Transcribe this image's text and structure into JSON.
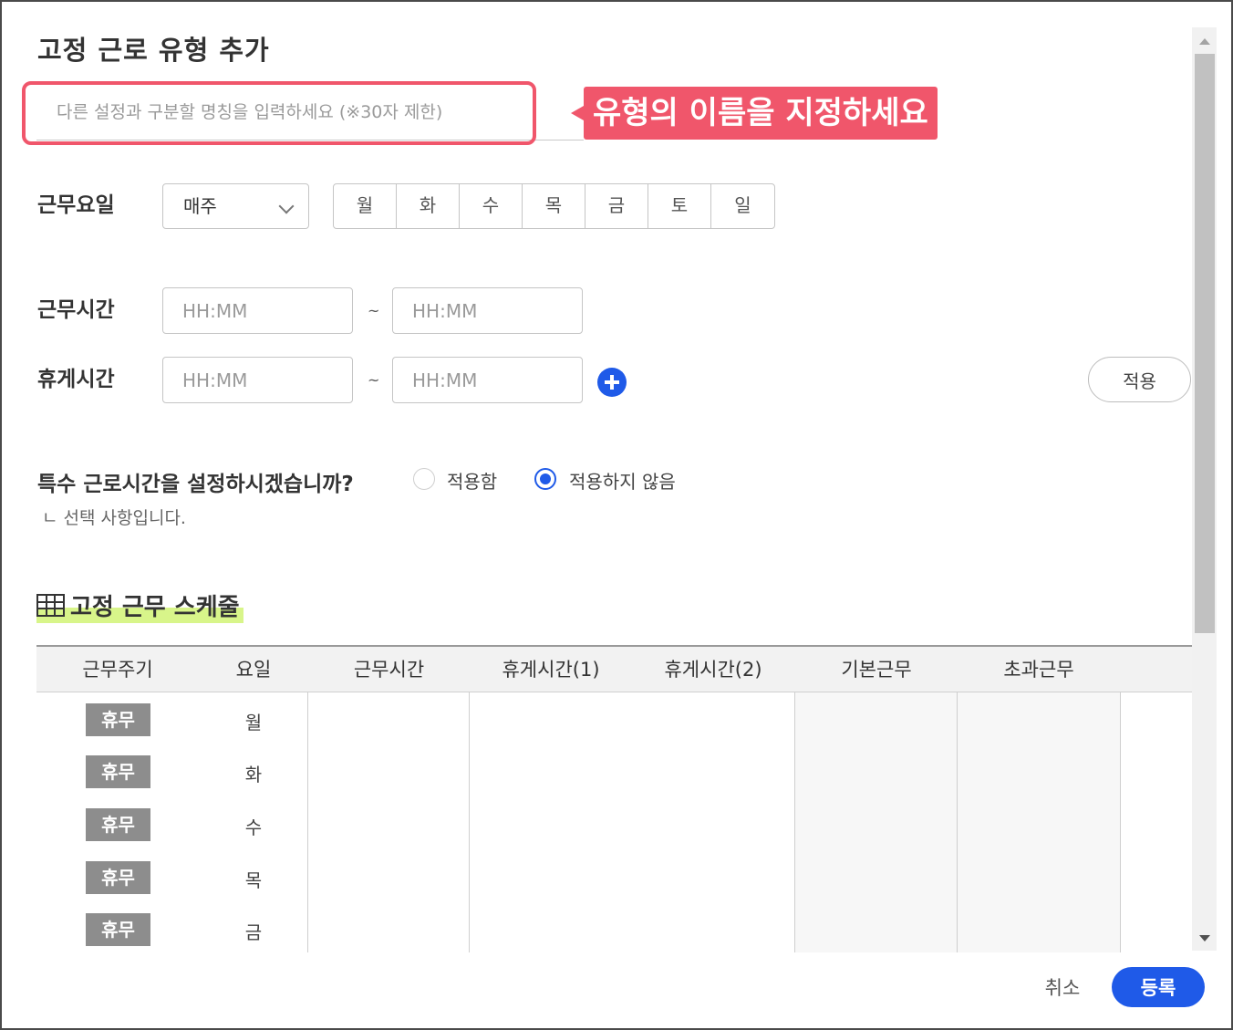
{
  "dialog": {
    "title": "고정 근로 유형 추가",
    "name_placeholder": "다른 설정과 구분할 명칭을 입력하세요 (※30자 제한)",
    "name_value": "",
    "callout": "유형의 이름을 지정하세요"
  },
  "work_days": {
    "label": "근무요일",
    "repeat_selected": "매주",
    "days": [
      "월",
      "화",
      "수",
      "목",
      "금",
      "토",
      "일"
    ]
  },
  "work_time": {
    "label": "근무시간",
    "start_placeholder": "HH:MM",
    "end_placeholder": "HH:MM",
    "separator": "~"
  },
  "break_time": {
    "label": "휴게시간",
    "start_placeholder": "HH:MM",
    "end_placeholder": "HH:MM",
    "separator": "~",
    "apply_label": "적용"
  },
  "special_hours": {
    "question": "특수 근로시간을 설정하시겠습니까?",
    "options": [
      {
        "label": "적용함",
        "selected": false
      },
      {
        "label": "적용하지 않음",
        "selected": true
      }
    ],
    "note": "ㄴ 선택 사항입니다."
  },
  "schedule": {
    "title": "고정 근무 스케줄",
    "columns": [
      "근무주기",
      "요일",
      "근무시간",
      "휴게시간(1)",
      "휴게시간(2)",
      "기본근무",
      "초과근무"
    ],
    "rows": [
      {
        "cycle": "휴무",
        "day": "월"
      },
      {
        "cycle": "휴무",
        "day": "화"
      },
      {
        "cycle": "휴무",
        "day": "수"
      },
      {
        "cycle": "휴무",
        "day": "목"
      },
      {
        "cycle": "휴무",
        "day": "금"
      }
    ]
  },
  "footer": {
    "cancel_label": "취소",
    "submit_label": "등록"
  },
  "colors": {
    "accent": "#1f5ae8",
    "callout": "#f0566b",
    "highlight": "#d8f58a",
    "badge": "#8d8d8d"
  }
}
